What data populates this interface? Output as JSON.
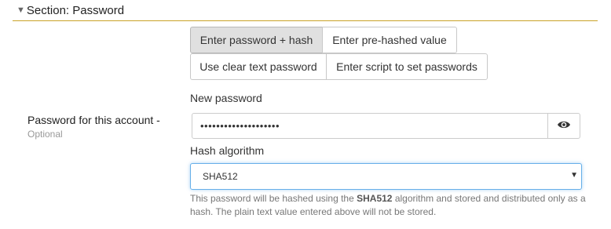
{
  "section": {
    "title": "Section: Password"
  },
  "mode_buttons": [
    {
      "label": "Enter password + hash",
      "active": true
    },
    {
      "label": "Enter pre-hashed value",
      "active": false
    },
    {
      "label": "Use clear text password",
      "active": false
    },
    {
      "label": "Enter script to set passwords",
      "active": false
    }
  ],
  "account_field": {
    "label": "Password for this account -",
    "sublabel": "Optional"
  },
  "new_password": {
    "label": "New password",
    "value": "••••••••••••••••••••"
  },
  "hash": {
    "label": "Hash algorithm",
    "selected": "SHA512",
    "help_prefix": "This password will be hashed using the ",
    "help_algo": "SHA512",
    "help_suffix": " algorithm and stored and distributed only as a hash. The plain text value entered above will not be stored."
  },
  "icons": {
    "collapse": "triangle-down-icon",
    "reveal": "eye-icon",
    "select": "caret-down-icon"
  },
  "colors": {
    "section_underline": "#c9a227",
    "select_focus": "#66afe9",
    "active_button": "#e0e0e0"
  }
}
